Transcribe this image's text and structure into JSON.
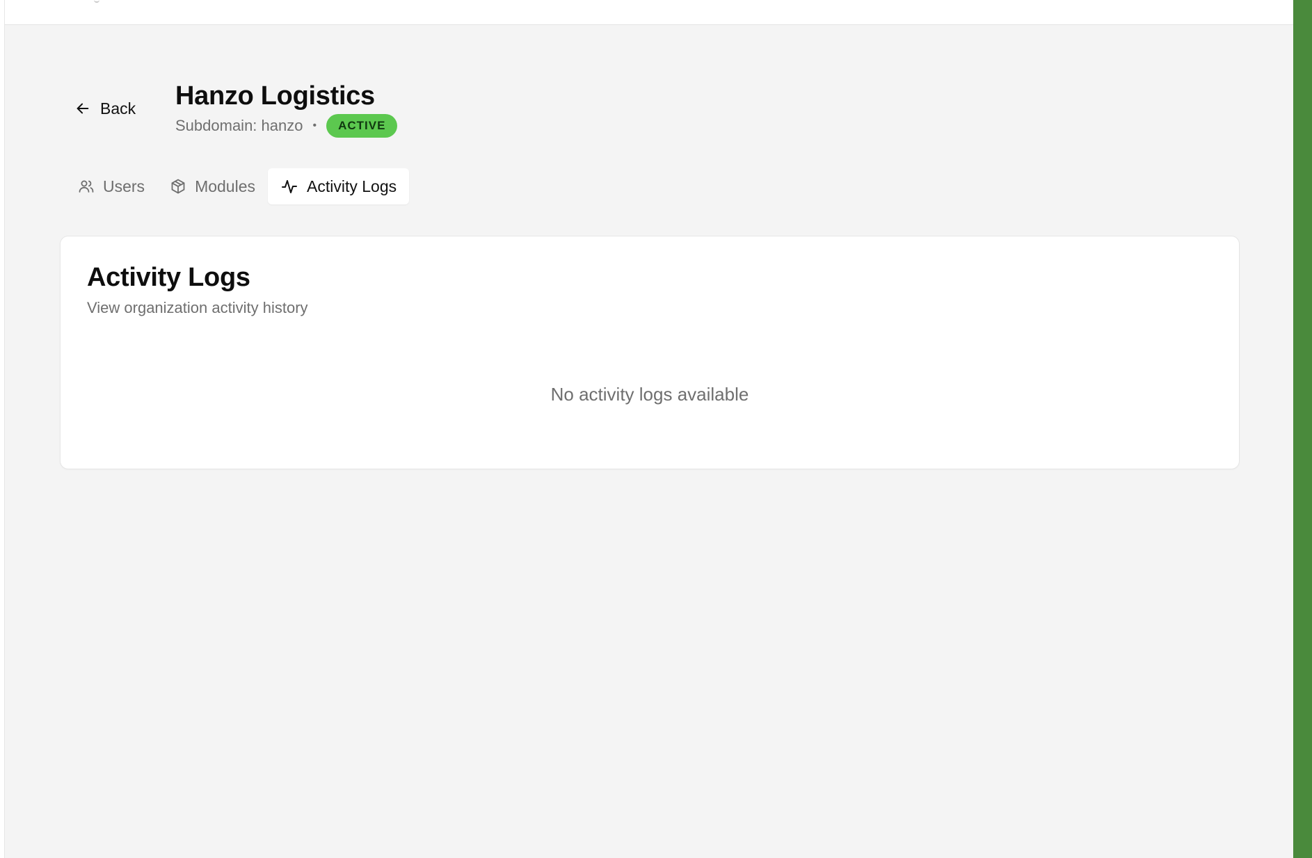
{
  "header": {
    "back_label": "Back",
    "org_name": "Hanzo Logistics",
    "subdomain_text": "Subdomain: hanzo",
    "separator": "•",
    "status": "ACTIVE"
  },
  "tabs": [
    {
      "label": "Users",
      "icon": "users-icon",
      "active": false
    },
    {
      "label": "Modules",
      "icon": "package-icon",
      "active": false
    },
    {
      "label": "Activity Logs",
      "icon": "activity-icon",
      "active": true
    }
  ],
  "card": {
    "title": "Activity Logs",
    "subtitle": "View organization activity history",
    "empty_message": "No activity logs available"
  },
  "colors": {
    "background": "#f4f4f4",
    "status_badge": "#5cc84f",
    "accent_strip": "#4a8a3c"
  }
}
